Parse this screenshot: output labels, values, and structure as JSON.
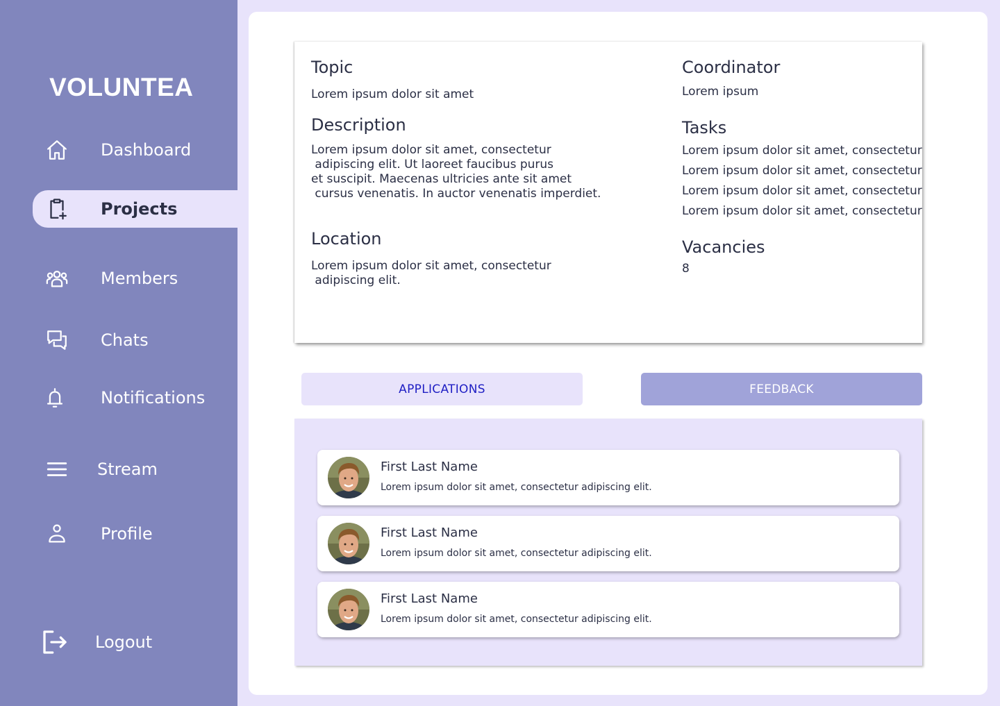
{
  "app": {
    "name": "VOLUNTEA"
  },
  "sidebar": {
    "items": [
      {
        "label": "Dashboard",
        "icon": "home-icon"
      },
      {
        "label": "Projects",
        "icon": "clipboard-plus-icon",
        "active": true
      },
      {
        "label": "Members",
        "icon": "users-icon"
      },
      {
        "label": "Chats",
        "icon": "chat-bubbles-icon"
      },
      {
        "label": "Notifications",
        "icon": "bell-icon"
      },
      {
        "label": "Stream",
        "icon": "menu-lines-icon"
      },
      {
        "label": "Profile",
        "icon": "user-icon"
      }
    ],
    "logout": {
      "label": "Logout",
      "icon": "logout-icon"
    }
  },
  "project": {
    "topic": {
      "label": "Topic",
      "value": "Lorem ipsum dolor sit amet"
    },
    "description": {
      "label": "Description",
      "value": "Lorem ipsum dolor sit amet, consectetur\n adipiscing elit. Ut laoreet faucibus purus\net suscipit. Maecenas ultricies ante sit amet\n cursus venenatis. In auctor venenatis imperdiet."
    },
    "location": {
      "label": "Location",
      "value": "Lorem ipsum dolor sit amet, consectetur\n adipiscing elit."
    },
    "coordinator": {
      "label": "Coordinator",
      "value": "Lorem ipsum"
    },
    "tasks": {
      "label": "Tasks",
      "items": [
        "Lorem ipsum dolor sit amet, consectetur",
        "Lorem ipsum dolor sit amet, consectetur",
        "Lorem ipsum dolor sit amet, consectetur",
        "Lorem ipsum dolor sit amet, consectetur"
      ]
    },
    "vacancies": {
      "label": "Vacancies",
      "value": "8"
    }
  },
  "tabs": {
    "applications": "APPLICATIONS",
    "feedback": "FEEDBACK"
  },
  "applications": [
    {
      "name": "First Last Name",
      "text": "Lorem ipsum dolor sit amet, consectetur  adipiscing elit."
    },
    {
      "name": "First Last Name",
      "text": "Lorem ipsum dolor sit amet, consectetur  adipiscing elit."
    },
    {
      "name": "First Last Name",
      "text": "Lorem ipsum dolor sit amet, consectetur  adipiscing elit."
    }
  ],
  "colors": {
    "sidebar": "#8186bd",
    "background": "#e8e3fb",
    "accent_text": "#1f1fc4",
    "feedback_tab": "#a0a3d9"
  }
}
